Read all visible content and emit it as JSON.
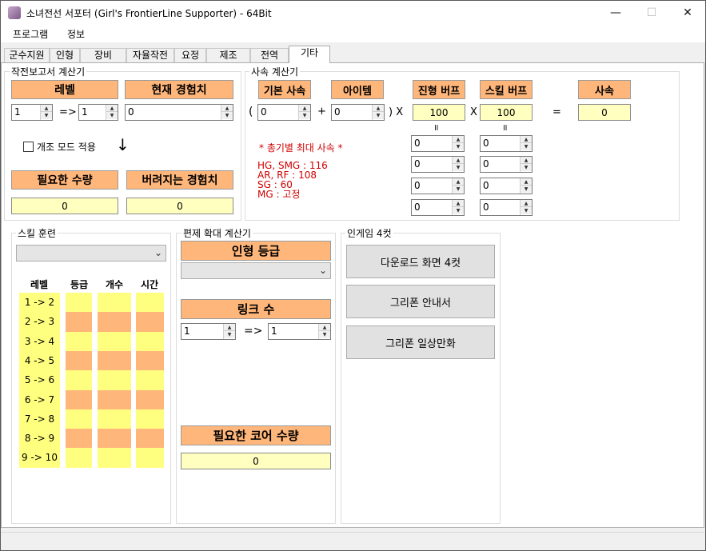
{
  "window": {
    "title": "소녀전선 서포터 (Girl's FrontierLine Supporter) - 64Bit",
    "icon": "app-icon",
    "minimize": "—",
    "maximize": "☐",
    "close": "✕"
  },
  "menu": [
    "프로그램",
    "정보"
  ],
  "tabs": [
    "군수지원",
    "인형",
    "장비",
    "자율작전",
    "요정",
    "제조",
    "전역",
    "기타"
  ],
  "active_tab": "기타",
  "report_calc": {
    "group_label": "작전보고서 계산기",
    "level_btn": "레벨",
    "exp_btn": "현재 경험치",
    "level_from": "1",
    "arrow": "=>",
    "level_to": "1",
    "exp_value": "0",
    "mod_checkbox_label": "개조 모드 적용",
    "mod_checked": false,
    "down_arrow": "↓",
    "required_btn": "필요한 수량",
    "wasted_btn": "버려지는 경험치",
    "required_value": "0",
    "wasted_value": "0"
  },
  "fire_calc": {
    "group_label": "사속 계산기",
    "base_btn": "기본 사속",
    "item_btn": "아이템",
    "formation_btn": "진형 버프",
    "skill_btn": "스킬 버프",
    "result_btn": "사속",
    "open_paren": "(",
    "plus": "+",
    "close_x": ") X",
    "times": "X",
    "equals": "=",
    "base_value": "0",
    "item_value": "0",
    "formation_value": "100",
    "skill_value": "100",
    "result_value": "0",
    "equal_mark": "॥",
    "formation_inputs": [
      "0",
      "0",
      "0",
      "0"
    ],
    "skill_inputs": [
      "0",
      "0",
      "0",
      "0"
    ],
    "max_title": "* 총기별 최대 사속 *",
    "max_lines": [
      "HG, SMG : 116",
      "AR, RF : 108",
      "SG : 60",
      "MG : 고정"
    ]
  },
  "skill_training": {
    "group_label": "스킬 훈련",
    "combo_value": "",
    "headers": [
      "레벨",
      "등급",
      "개수",
      "시간"
    ],
    "rows": [
      "1 -> 2",
      "2 -> 3",
      "3 -> 4",
      "4 -> 5",
      "5 -> 6",
      "6 -> 7",
      "7 -> 8",
      "8 -> 9",
      "9 -> 10"
    ]
  },
  "expansion_calc": {
    "group_label": "편제 확대 계산기",
    "grade_btn": "인형 등급",
    "grade_combo": "",
    "link_btn": "링크 수",
    "link_from": "1",
    "arrow": "=>",
    "link_to": "1",
    "core_btn": "필요한 코어 수량",
    "core_value": "0"
  },
  "comics": {
    "group_label": "인게임 4컷",
    "buttons": [
      "다운로드 화면 4컷",
      "그리폰 안내서",
      "그리폰 일상만화"
    ]
  },
  "colors": {
    "orange": "#ffb67a",
    "light_yellow": "#ffffbf",
    "yellow": "#ffff7f",
    "red_text": "#d00000"
  }
}
